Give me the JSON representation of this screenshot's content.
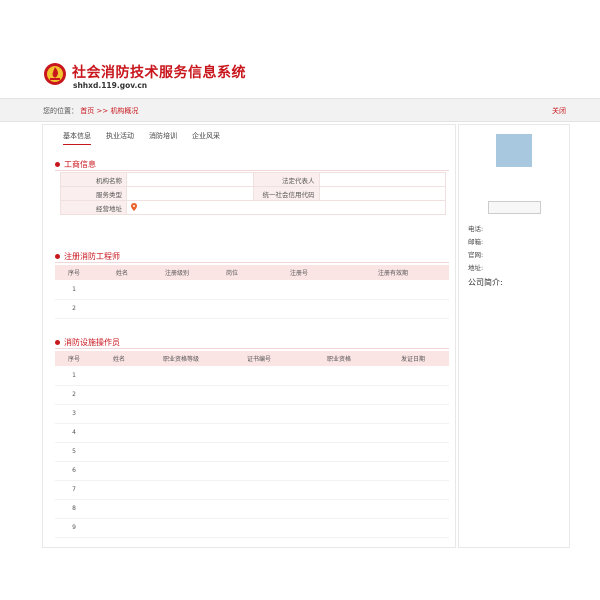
{
  "header": {
    "title": "社会消防技术服务信息系统",
    "domain": "shhxd.119.gov.cn",
    "colors": {
      "brand": "#c8161d"
    }
  },
  "breadcrumb": {
    "label": "您的位置：",
    "home": "首页",
    "separator": ">>",
    "current": "机构概况",
    "close": "关闭"
  },
  "tabs": [
    "基本信息",
    "执业活动",
    "消防培训",
    "企业风采"
  ],
  "business_info": {
    "title": "工商信息",
    "rows": [
      [
        {
          "k": "机构名称",
          "v": ""
        },
        {
          "k": "法定代表人",
          "v": ""
        }
      ],
      [
        {
          "k": "服务类型",
          "v": ""
        },
        {
          "k": "统一社会信用代码",
          "v": ""
        }
      ]
    ],
    "address_label": "经营地址",
    "address_value": ""
  },
  "engineers": {
    "title": "注册消防工程师",
    "columns": [
      "序号",
      "姓名",
      "注册级别",
      "岗位",
      "注册号",
      "注册有效期"
    ],
    "rows": [
      [
        "1",
        "",
        "",
        "",
        "",
        ""
      ],
      [
        "2",
        "",
        "",
        "",
        "",
        ""
      ]
    ]
  },
  "operators": {
    "title": "消防设施操作员",
    "columns": [
      "序号",
      "姓名",
      "职业资格等级",
      "证书编号",
      "职业资格",
      "发证日期"
    ],
    "rows": [
      [
        "1",
        "",
        "",
        "",
        "",
        ""
      ],
      [
        "2",
        "",
        "",
        "",
        "",
        ""
      ],
      [
        "3",
        "",
        "",
        "",
        "",
        ""
      ],
      [
        "4",
        "",
        "",
        "",
        "",
        ""
      ],
      [
        "5",
        "",
        "",
        "",
        "",
        ""
      ],
      [
        "6",
        "",
        "",
        "",
        "",
        ""
      ],
      [
        "7",
        "",
        "",
        "",
        "",
        ""
      ],
      [
        "8",
        "",
        "",
        "",
        "",
        ""
      ],
      [
        "9",
        "",
        "",
        "",
        "",
        ""
      ]
    ]
  },
  "side": {
    "company": "",
    "button": "",
    "fields": [
      "电话:",
      "邮箱:",
      "官网:",
      "地址:"
    ],
    "intro": "公司简介:"
  },
  "icons": {
    "emblem": "fire-emblem-icon",
    "section": "red-dot-icon",
    "location": "location-pin-icon"
  }
}
